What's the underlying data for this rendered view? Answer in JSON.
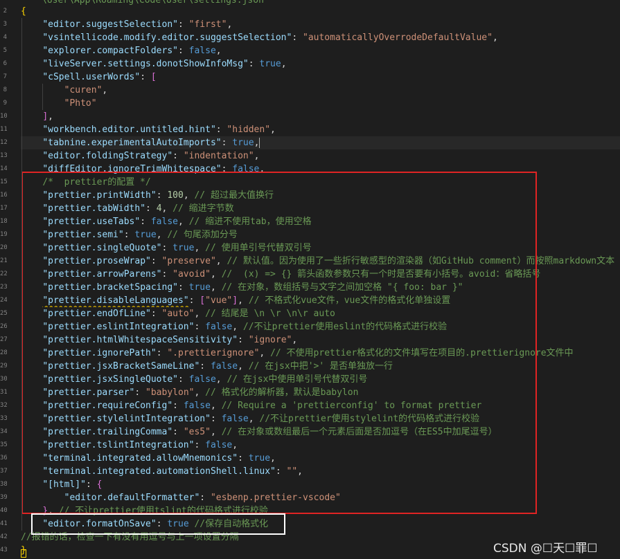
{
  "top_clip": "\\User\\App\\Roaming\\Code\\User\\settings.json",
  "watermark": "CSDN @☐天☐罪☐",
  "lines": [
    {
      "indent": "",
      "toks": [
        [
          "br1",
          "{"
        ]
      ]
    },
    {
      "indent": "    ",
      "toks": [
        [
          "k",
          "\"editor.suggestSelection\""
        ],
        [
          "p",
          ": "
        ],
        [
          "s",
          "\"first\""
        ],
        [
          "p",
          ","
        ]
      ]
    },
    {
      "indent": "    ",
      "toks": [
        [
          "k",
          "\"vsintellicode.modify.editor.suggestSelection\""
        ],
        [
          "p",
          ": "
        ],
        [
          "s",
          "\"automaticallyOverrodeDefaultValue\""
        ],
        [
          "p",
          ","
        ]
      ]
    },
    {
      "indent": "    ",
      "toks": [
        [
          "k",
          "\"explorer.compactFolders\""
        ],
        [
          "p",
          ": "
        ],
        [
          "b",
          "false"
        ],
        [
          "p",
          ","
        ]
      ]
    },
    {
      "indent": "    ",
      "toks": [
        [
          "k",
          "\"liveServer.settings.donotShowInfoMsg\""
        ],
        [
          "p",
          ": "
        ],
        [
          "b",
          "true"
        ],
        [
          "p",
          ","
        ]
      ]
    },
    {
      "indent": "    ",
      "toks": [
        [
          "k",
          "\"cSpell.userWords\""
        ],
        [
          "p",
          ": "
        ],
        [
          "br2",
          "["
        ]
      ]
    },
    {
      "indent": "        ",
      "toks": [
        [
          "s",
          "\"curen\""
        ],
        [
          "p",
          ","
        ]
      ]
    },
    {
      "indent": "        ",
      "toks": [
        [
          "s",
          "\"Phto\""
        ]
      ]
    },
    {
      "indent": "    ",
      "toks": [
        [
          "br2",
          "]"
        ],
        [
          "p",
          ","
        ]
      ]
    },
    {
      "indent": "    ",
      "toks": [
        [
          "k",
          "\"workbench.editor.untitled.hint\""
        ],
        [
          "p",
          ": "
        ],
        [
          "s",
          "\"hidden\""
        ],
        [
          "p",
          ","
        ]
      ]
    },
    {
      "indent": "    ",
      "cursor": true,
      "toks": [
        [
          "k",
          "\"tabnine.experimentalAutoImports\""
        ],
        [
          "p",
          ": "
        ],
        [
          "b",
          "true"
        ],
        [
          "p",
          ","
        ]
      ]
    },
    {
      "indent": "    ",
      "toks": [
        [
          "k",
          "\"editor.foldingStrategy\""
        ],
        [
          "p",
          ": "
        ],
        [
          "s",
          "\"indentation\""
        ],
        [
          "p",
          ","
        ]
      ]
    },
    {
      "indent": "    ",
      "toks": [
        [
          "k",
          "\"diffEditor.ignoreTrimWhitespace\""
        ],
        [
          "p",
          ": "
        ],
        [
          "b",
          "false"
        ],
        [
          "p",
          ","
        ]
      ]
    },
    {
      "indent": "    ",
      "toks": [
        [
          "c",
          "/*  prettier的配置 */"
        ]
      ]
    },
    {
      "indent": "    ",
      "toks": [
        [
          "k",
          "\"prettier.printWidth\""
        ],
        [
          "p",
          ": "
        ],
        [
          "n",
          "100"
        ],
        [
          "p",
          ", "
        ],
        [
          "c",
          "// 超过最大值换行"
        ]
      ]
    },
    {
      "indent": "    ",
      "toks": [
        [
          "k",
          "\"prettier.tabWidth\""
        ],
        [
          "p",
          ": "
        ],
        [
          "n",
          "4"
        ],
        [
          "p",
          ", "
        ],
        [
          "c",
          "// 缩进字节数"
        ]
      ]
    },
    {
      "indent": "    ",
      "toks": [
        [
          "k",
          "\"prettier.useTabs\""
        ],
        [
          "p",
          ": "
        ],
        [
          "b",
          "false"
        ],
        [
          "p",
          ", "
        ],
        [
          "c",
          "// 缩进不使用tab，使用空格"
        ]
      ]
    },
    {
      "indent": "    ",
      "toks": [
        [
          "k",
          "\"prettier.semi\""
        ],
        [
          "p",
          ": "
        ],
        [
          "b",
          "true"
        ],
        [
          "p",
          ", "
        ],
        [
          "c",
          "// 句尾添加分号"
        ]
      ]
    },
    {
      "indent": "    ",
      "toks": [
        [
          "k",
          "\"prettier.singleQuote\""
        ],
        [
          "p",
          ": "
        ],
        [
          "b",
          "true"
        ],
        [
          "p",
          ", "
        ],
        [
          "c",
          "// 使用单引号代替双引号"
        ]
      ]
    },
    {
      "indent": "    ",
      "toks": [
        [
          "k",
          "\"prettier.proseWrap\""
        ],
        [
          "p",
          ": "
        ],
        [
          "s",
          "\"preserve\""
        ],
        [
          "p",
          ", "
        ],
        [
          "c",
          "// 默认值。因为使用了一些折行敏感型的渲染器（如GitHub comment）而按照markdown文本"
        ]
      ]
    },
    {
      "indent": "    ",
      "toks": [
        [
          "k",
          "\"prettier.arrowParens\""
        ],
        [
          "p",
          ": "
        ],
        [
          "s",
          "\"avoid\""
        ],
        [
          "p",
          ", "
        ],
        [
          "c",
          "//  (x) => {} 箭头函数参数只有一个时是否要有小括号。avoid：省略括号"
        ]
      ]
    },
    {
      "indent": "    ",
      "toks": [
        [
          "k",
          "\"prettier.bracketSpacing\""
        ],
        [
          "p",
          ": "
        ],
        [
          "b",
          "true"
        ],
        [
          "p",
          ", "
        ],
        [
          "c",
          "// 在对象，数组括号与文字之间加空格 \"{ foo: bar }\""
        ]
      ]
    },
    {
      "indent": "    ",
      "toks": [
        [
          "ksq",
          "\"prettier.disableLanguages\""
        ],
        [
          "p",
          ": "
        ],
        [
          "br2",
          "["
        ],
        [
          "s",
          "\"vue\""
        ],
        [
          "br2",
          "]"
        ],
        [
          "p",
          ", "
        ],
        [
          "c",
          "// 不格式化vue文件，vue文件的格式化单独设置"
        ]
      ]
    },
    {
      "indent": "    ",
      "toks": [
        [
          "k",
          "\"prettier.endOfLine\""
        ],
        [
          "p",
          ": "
        ],
        [
          "s",
          "\"auto\""
        ],
        [
          "p",
          ", "
        ],
        [
          "c",
          "// 结尾是 \\n \\r \\n\\r auto"
        ]
      ]
    },
    {
      "indent": "    ",
      "toks": [
        [
          "k",
          "\"prettier.eslintIntegration\""
        ],
        [
          "p",
          ": "
        ],
        [
          "b",
          "false"
        ],
        [
          "p",
          ", "
        ],
        [
          "c",
          "//不让prettier使用eslint的代码格式进行校验"
        ]
      ]
    },
    {
      "indent": "    ",
      "toks": [
        [
          "k",
          "\"prettier.htmlWhitespaceSensitivity\""
        ],
        [
          "p",
          ": "
        ],
        [
          "s",
          "\"ignore\""
        ],
        [
          "p",
          ","
        ]
      ]
    },
    {
      "indent": "    ",
      "toks": [
        [
          "k",
          "\"prettier.ignorePath\""
        ],
        [
          "p",
          ": "
        ],
        [
          "s",
          "\".prettierignore\""
        ],
        [
          "p",
          ", "
        ],
        [
          "c",
          "// 不使用prettier格式化的文件填写在项目的.prettierignore文件中"
        ]
      ]
    },
    {
      "indent": "    ",
      "toks": [
        [
          "k",
          "\"prettier.jsxBracketSameLine\""
        ],
        [
          "p",
          ": "
        ],
        [
          "b",
          "false"
        ],
        [
          "p",
          ", "
        ],
        [
          "c",
          "// 在jsx中把'>' 是否单独放一行"
        ]
      ]
    },
    {
      "indent": "    ",
      "toks": [
        [
          "k",
          "\"prettier.jsxSingleQuote\""
        ],
        [
          "p",
          ": "
        ],
        [
          "b",
          "false"
        ],
        [
          "p",
          ", "
        ],
        [
          "c",
          "// 在jsx中使用单引号代替双引号"
        ]
      ]
    },
    {
      "indent": "    ",
      "toks": [
        [
          "k",
          "\"prettier.parser\""
        ],
        [
          "p",
          ": "
        ],
        [
          "s",
          "\"babylon\""
        ],
        [
          "p",
          ", "
        ],
        [
          "c",
          "// 格式化的解析器，默认是babylon"
        ]
      ]
    },
    {
      "indent": "    ",
      "toks": [
        [
          "k",
          "\"prettier.requireConfig\""
        ],
        [
          "p",
          ": "
        ],
        [
          "b",
          "false"
        ],
        [
          "p",
          ", "
        ],
        [
          "c",
          "// Require a 'prettierconfig' to format prettier"
        ]
      ]
    },
    {
      "indent": "    ",
      "toks": [
        [
          "k",
          "\"prettier.stylelintIntegration\""
        ],
        [
          "p",
          ": "
        ],
        [
          "b",
          "false"
        ],
        [
          "p",
          ", "
        ],
        [
          "c",
          "//不让prettier使用stylelint的代码格式进行校验"
        ]
      ]
    },
    {
      "indent": "    ",
      "toks": [
        [
          "k",
          "\"prettier.trailingComma\""
        ],
        [
          "p",
          ": "
        ],
        [
          "s",
          "\"es5\""
        ],
        [
          "p",
          ", "
        ],
        [
          "c",
          "// 在对象或数组最后一个元素后面是否加逗号（在ES5中加尾逗号）"
        ]
      ]
    },
    {
      "indent": "    ",
      "toks": [
        [
          "k",
          "\"prettier.tslintIntegration\""
        ],
        [
          "p",
          ": "
        ],
        [
          "b",
          "false"
        ],
        [
          "p",
          ","
        ]
      ]
    },
    {
      "indent": "    ",
      "toks": [
        [
          "k",
          "\"terminal.integrated.allowMnemonics\""
        ],
        [
          "p",
          ": "
        ],
        [
          "b",
          "true"
        ],
        [
          "p",
          ","
        ]
      ]
    },
    {
      "indent": "    ",
      "toks": [
        [
          "k",
          "\"terminal.integrated.automationShell.linux\""
        ],
        [
          "p",
          ": "
        ],
        [
          "s",
          "\"\""
        ],
        [
          "p",
          ","
        ]
      ]
    },
    {
      "indent": "    ",
      "toks": [
        [
          "k",
          "\"[html]\""
        ],
        [
          "p",
          ": "
        ],
        [
          "br2",
          "{"
        ]
      ]
    },
    {
      "indent": "        ",
      "toks": [
        [
          "k",
          "\"editor.defaultFormatter\""
        ],
        [
          "p",
          ": "
        ],
        [
          "s",
          "\"esbenp.prettier-vscode\""
        ]
      ]
    },
    {
      "indent": "    ",
      "toks": [
        [
          "br2",
          "}"
        ],
        [
          "p",
          ", "
        ],
        [
          "c",
          "// 不让prettier使用tslint的代码格式进行校验"
        ]
      ]
    },
    {
      "indent": "    ",
      "toks": [
        [
          "k",
          "\"editor.formatOnSave\""
        ],
        [
          "p",
          ": "
        ],
        [
          "b",
          "true"
        ],
        [
          "p",
          " "
        ],
        [
          "c",
          "//保存自动格式化"
        ]
      ]
    },
    {
      "indent": "",
      "toks": [
        [
          "c",
          "//报错的话，检查一下有没有用逗号与上一项设置分隔"
        ]
      ]
    },
    {
      "indent": "",
      "toks": [
        [
          "br1",
          "}"
        ]
      ]
    }
  ]
}
